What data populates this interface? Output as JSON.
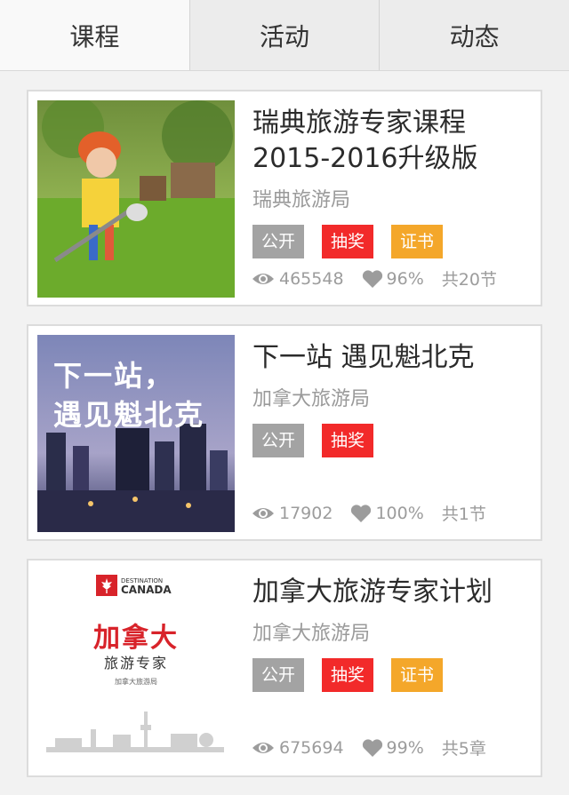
{
  "tabs": [
    {
      "label": "课程"
    },
    {
      "label": "活动"
    },
    {
      "label": "动态"
    }
  ],
  "courses": [
    {
      "title": "瑞典旅游专家课程2015-2016升级版",
      "org": "瑞典旅游局",
      "tags": [
        "公开",
        "抽奖",
        "证书"
      ],
      "views": "465548",
      "likes": "96%",
      "count": "共20节"
    },
    {
      "title": "下一站 遇见魁北克",
      "org": "加拿大旅游局",
      "tags": [
        "公开",
        "抽奖"
      ],
      "views": "17902",
      "likes": "100%",
      "count": "共1节",
      "image_text_line1": "下一站，",
      "image_text_line2": "遇见魁北克"
    },
    {
      "title": "加拿大旅游专家计划",
      "org": "加拿大旅游局",
      "tags": [
        "公开",
        "抽奖",
        "证书"
      ],
      "views": "675694",
      "likes": "99%",
      "count": "共5章",
      "image_logo_top": "DESTINATION",
      "image_logo_bottom": "CANADA",
      "image_big": "加拿大",
      "image_sub": "旅游专家",
      "image_tiny": "加拿大旅游局"
    }
  ],
  "colors": {
    "tag_gray": "#a3a3a3",
    "tag_red": "#f22a2a",
    "tag_orange": "#f4a72a"
  }
}
